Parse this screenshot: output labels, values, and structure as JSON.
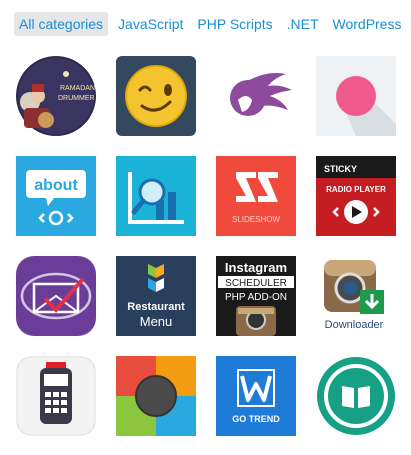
{
  "tabs": [
    {
      "label": "All categories",
      "active": true
    },
    {
      "label": "JavaScript",
      "active": false
    },
    {
      "label": "PHP Scripts",
      "active": false
    },
    {
      "label": ".NET",
      "active": false
    },
    {
      "label": "WordPress",
      "active": false
    }
  ],
  "items": [
    {
      "icon": "ramadan-drummer-icon",
      "text1": "RAMADAN",
      "text2": "DRUMMER"
    },
    {
      "icon": "winking-emoji-icon"
    },
    {
      "icon": "woman-silhouette-icon"
    },
    {
      "icon": "pink-circle-icon"
    },
    {
      "icon": "about-bubble-icon",
      "text1": "about"
    },
    {
      "icon": "chart-magnifier-icon"
    },
    {
      "icon": "slideshow-icon",
      "text1": "SLIDESHOW"
    },
    {
      "icon": "sticky-radio-player-icon",
      "text1": "STICKY",
      "text2": "RADIO PLAYER"
    },
    {
      "icon": "envelope-check-icon"
    },
    {
      "icon": "restaurant-menu-icon",
      "text1": "Restaurant",
      "text2": "Menu"
    },
    {
      "icon": "instagram-scheduler-icon",
      "text1": "Instagram",
      "text2": "SCHEDULER",
      "text3": "PHP ADD-ON"
    },
    {
      "icon": "instagram-downloader-icon",
      "text1": "Downloader"
    },
    {
      "icon": "payment-terminal-icon"
    },
    {
      "icon": "color-grid-circle-icon"
    },
    {
      "icon": "go-trend-icon",
      "text1": "GO TREND"
    },
    {
      "icon": "open-book-icon"
    }
  ],
  "colors": {
    "link": "#1a8fd1",
    "active_tab_bg": "#e4e6e8"
  }
}
